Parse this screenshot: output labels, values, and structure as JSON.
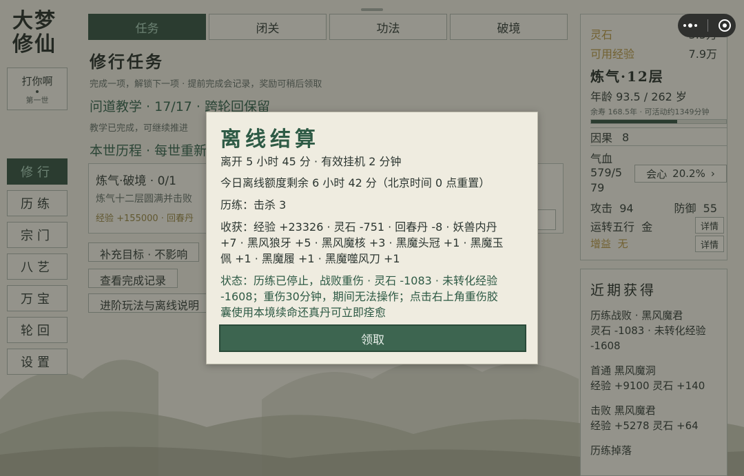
{
  "app": {
    "logo_line1": "大梦",
    "logo_line2": "修仙"
  },
  "player": {
    "name": "打你啊",
    "generation": "第一世"
  },
  "nav": {
    "items": [
      {
        "label": "修行",
        "active": true
      },
      {
        "label": "历练"
      },
      {
        "label": "宗门"
      },
      {
        "label": "八艺"
      },
      {
        "label": "万宝"
      },
      {
        "label": "轮回"
      },
      {
        "label": "设置"
      }
    ]
  },
  "tabs": [
    {
      "label": "任务",
      "active": true
    },
    {
      "label": "闭关"
    },
    {
      "label": "功法"
    },
    {
      "label": "破境"
    }
  ],
  "main": {
    "title": "修行任务",
    "desc": "完成一项，解锁下一项 · 提前完成会记录，奖励可稍后领取",
    "line_a": "问道教学 · 17/17 · 跨轮回保留",
    "line_a_sub": "教学已完成，可继续推进",
    "line_b": "本世历程 · 每世重新",
    "quest": {
      "title": "炼气·破境 · 0/1",
      "desc": "炼气十二层圆满并击败",
      "reward": "经验 +155000 · 回春丹"
    },
    "btn_supplement": "补充目标 · 不影响",
    "btn_records": "查看完成记录",
    "btn_guide": "进阶玩法与离线说明"
  },
  "stats": {
    "spirit_stone_label": "灵石",
    "spirit_stone_value": "3.5万",
    "exp_label": "可用经验",
    "exp_value": "7.9万",
    "realm": "炼气·12层",
    "age": "年龄 93.5 / 262 岁",
    "lifespan": "余寿 168.5年 · 可活动约1349分钟",
    "lifespan_fraction": 0.64,
    "karma_label": "因果",
    "karma_value": "8",
    "hp_label": "气血",
    "hp_value_line1": "579/5",
    "hp_value_line2": "79",
    "heart_label": "会心",
    "heart_value": "20.2%",
    "heart_arrow": "›",
    "attack_label": "攻击",
    "attack_value": "94",
    "defense_label": "防御",
    "defense_value": "55",
    "elements_label": "运转五行",
    "elements_value": "金",
    "detail_label": "详情",
    "buff_label": "增益",
    "buff_value": "无"
  },
  "recent": {
    "title": "近期获得",
    "items": [
      {
        "line1": "历练战败 · 黑风魔君",
        "line2": "灵石 -1083 · 未转化经验",
        "line3": "-1608"
      },
      {
        "line1": "首通 黑风魔洞",
        "line2": "经验 +9100 灵石 +140"
      },
      {
        "line1": "击败 黑风魔君",
        "line2": "经验 +5278 灵石 +64"
      },
      {
        "line1": "历练掉落"
      }
    ]
  },
  "modal": {
    "title": "离线结算",
    "away": "离开 5 小时 45 分 · 有效挂机 2 分钟",
    "quota": "今日离线额度剩余 6 小时 42 分（北京时间 0 点重置）",
    "kills": "历练：击杀 3",
    "gains_line1": "收获：经验 +23326 · 灵石 -751 · 回春丹 -8 · 妖兽内丹",
    "gains_line2": "+7 · 黑风狼牙 +5 · 黑风魔核 +3 · 黑魔头冠 +1 · 黑魔玉",
    "gains_line3": "佩 +1 · 黑魔履 +1 · 黑魔噬风刀 +1",
    "status_line1": "状态：历练已停止，战败重伤 · 灵石 -1083 · 未转化经验",
    "status_line2": "-1608；重伤30分钟，期间无法操作；点击右上角重伤胶",
    "status_line3": "囊使用本境续命还真丹可立即痊愈",
    "claim": "领取"
  },
  "colors": {
    "accent": "#2e4a3b",
    "accent_text": "#2e5a45",
    "gold": "#a78b3d",
    "panel": "#e2e1d8"
  }
}
